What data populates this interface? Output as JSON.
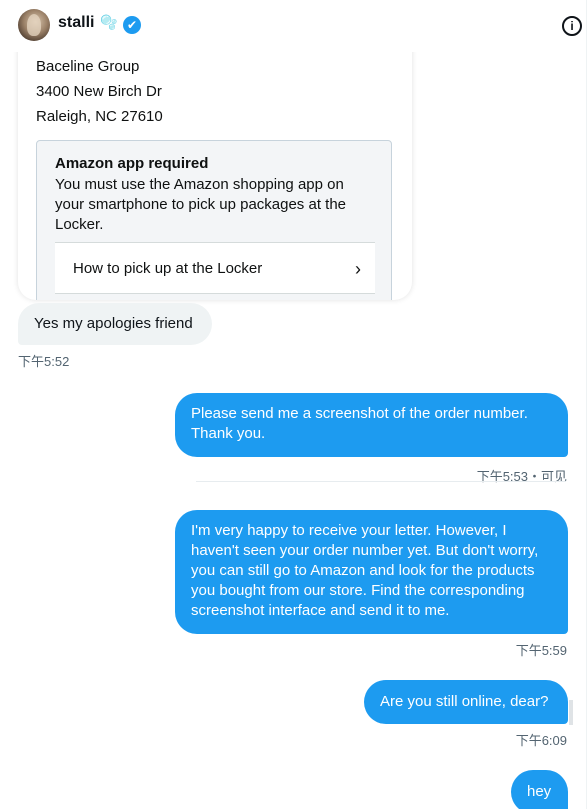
{
  "header": {
    "username": "stalli",
    "emoji": "🫧",
    "verified_glyph": "✔",
    "info_glyph": "i"
  },
  "shared_card": {
    "address_lines": [
      "Baceline Group",
      "3400 New Birch Dr",
      "Raleigh, NC 27610"
    ],
    "notice_title": "Amazon app required",
    "notice_body": "You must use the Amazon shopping app on your smartphone to pick up packages at the Locker.",
    "link_label": "How to pick up at the Locker",
    "link_chevron": "›"
  },
  "messages": [
    {
      "direction": "received",
      "text": "Yes my apologies friend",
      "time": "下午5:52"
    },
    {
      "direction": "sent",
      "text": "Please send me a screenshot of the order number. Thank you.",
      "time": "下午5:53・可见"
    },
    {
      "direction": "sent",
      "text": "I'm very happy to receive your letter. However, I haven't seen your order number yet. But don't worry, you can still go to Amazon and look for the products you bought from our store. Find the corresponding screenshot interface and send it to me.",
      "time": "下午5:59"
    },
    {
      "direction": "sent",
      "text": "Are you still online, dear?",
      "time": "下午6:09"
    },
    {
      "direction": "sent",
      "text": "hey",
      "time": ""
    }
  ],
  "colors": {
    "sent_bubble": "#1d9bf0",
    "received_bubble": "#eff3f4",
    "timestamp": "#536471"
  }
}
